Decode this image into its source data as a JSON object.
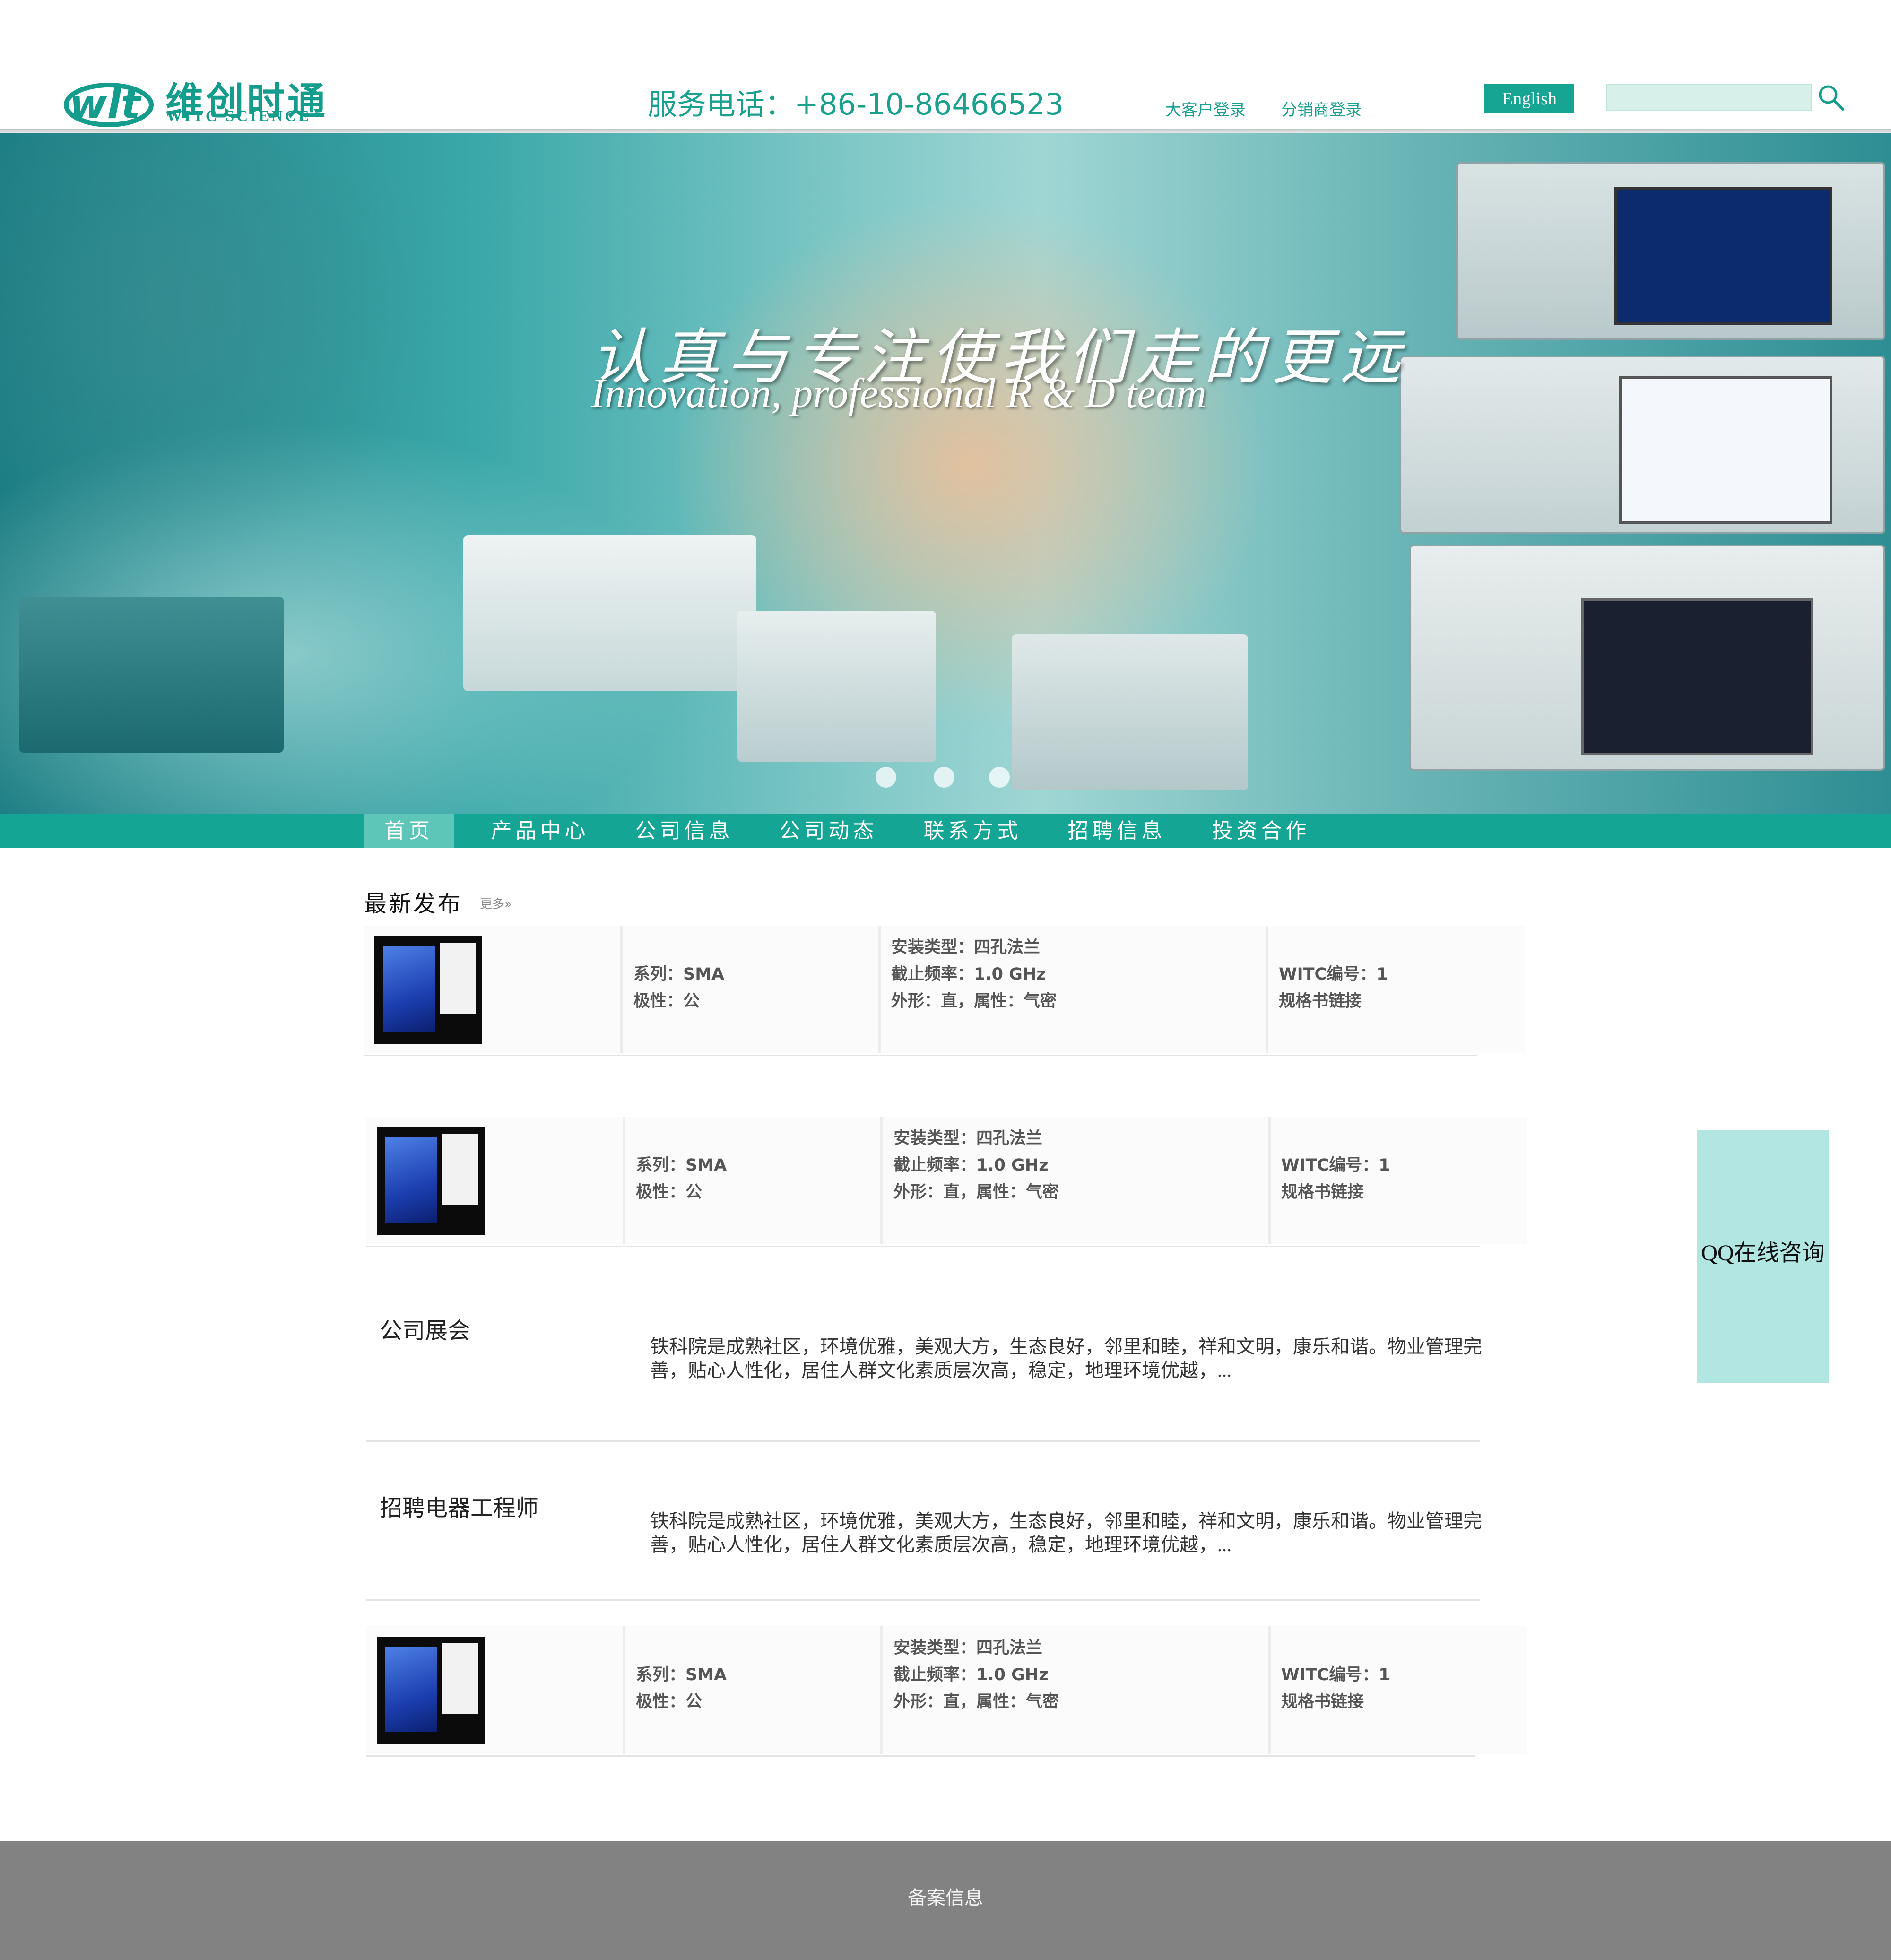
{
  "header": {
    "logo_cn": "维创时通",
    "logo_en": "WITC SCIENCE",
    "phone": "服务电话：+86-10-86466523",
    "links": [
      "大客户登录",
      "分销商登录"
    ],
    "language_button": "English",
    "search_placeholder": ""
  },
  "banner": {
    "title_cn": "认真与专注使我们走的更远",
    "title_en": "Innovation, professional R & D team",
    "slide_count": 3
  },
  "nav": {
    "items": [
      "首页",
      "产品中心",
      "公司信息",
      "公司动态",
      "联系方式",
      "招聘信息",
      "投资合作"
    ],
    "active": "首页"
  },
  "section": {
    "title": "最新发布",
    "more": "更多»"
  },
  "product": {
    "series": "系列：SMA",
    "polarity": "极性：公",
    "mount": "安装类型：四孔法兰",
    "cutoff": "截止频率：1.0 GHz",
    "shape": "外形：直，属性：气密",
    "witc_no": "WITC编号：1",
    "spec_link": "规格书链接"
  },
  "news": [
    {
      "title": "公司展会",
      "body": "铁科院是成熟社区，环境优雅，美观大方，生态良好，邻里和睦，祥和文明，康乐和谐。物业管理完善，贴心人性化，居住人群文化素质层次高，稳定，地理环境优越，..."
    },
    {
      "title": "招聘电器工程师",
      "body": "铁科院是成熟社区，环境优雅，美观大方，生态良好，邻里和睦，祥和文明，康乐和谐。物业管理完善，贴心人性化，居住人群文化素质层次高，稳定，地理环境优越，..."
    }
  ],
  "qq": "QQ在线咨询",
  "footer": "备案信息",
  "colors": {
    "brand": "#14a595",
    "brand_text": "#1aa08f",
    "nav_active": "#5ec5b9",
    "qq_bg": "#b2e6e2",
    "footer_bg": "#828282"
  }
}
